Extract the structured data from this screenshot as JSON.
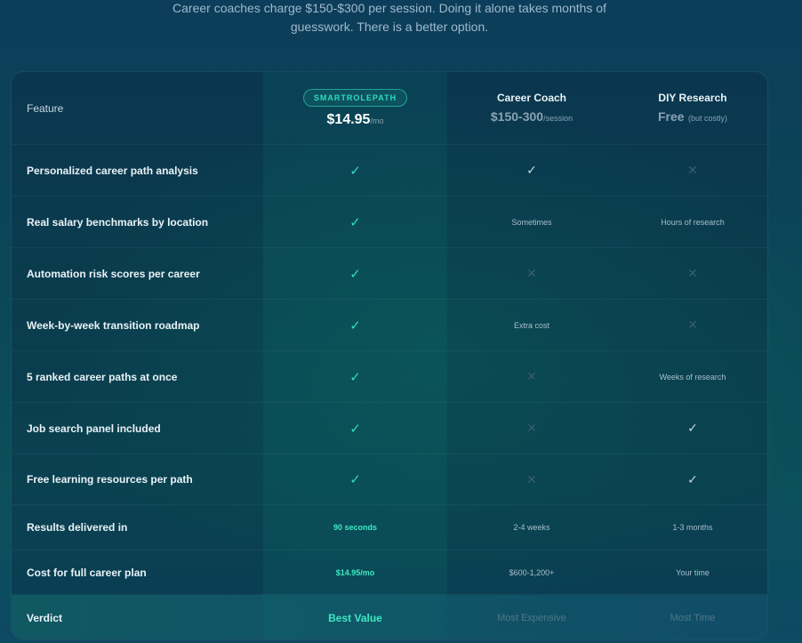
{
  "intro": {
    "line1": "Career coaches charge $150-$300 per session. Doing it alone takes months of",
    "line2": "guesswork. There is a better option."
  },
  "header": {
    "feature_label": "Feature",
    "plans": [
      {
        "badge": "SMARTROLEPATH",
        "price": "$14.95",
        "unit": "/mo"
      },
      {
        "name": "Career Coach",
        "price": "$150-300",
        "unit": "/session"
      },
      {
        "name": "DIY Research",
        "price": "Free",
        "unit": "(but costly)"
      }
    ]
  },
  "rows": [
    {
      "feature": "Personalized career path analysis",
      "values": [
        "✓",
        "✓",
        "✕"
      ]
    },
    {
      "feature": "Real salary benchmarks by location",
      "values": [
        "✓",
        "Sometimes",
        "Hours of research"
      ]
    },
    {
      "feature": "Automation risk scores per career",
      "values": [
        "✓",
        "✕",
        "✕"
      ]
    },
    {
      "feature": "Week-by-week transition roadmap",
      "values": [
        "✓",
        "Extra cost",
        "✕"
      ]
    },
    {
      "feature": "5 ranked career paths at once",
      "values": [
        "✓",
        "✕",
        "Weeks of research"
      ]
    },
    {
      "feature": "Job search panel included",
      "values": [
        "✓",
        "✕",
        "✓"
      ]
    },
    {
      "feature": "Free learning resources per path",
      "values": [
        "✓",
        "✕",
        "✓"
      ]
    },
    {
      "feature": "Results delivered in",
      "values": [
        "90 seconds",
        "2-4 weeks",
        "1-3 months"
      ]
    },
    {
      "feature": "Cost for full career plan",
      "values": [
        "$14.95/mo",
        "$600-1,200+",
        "Your time"
      ]
    }
  ],
  "verdict": {
    "label": "Verdict",
    "values": [
      "Best Value",
      "Most Expensive",
      "Most Time"
    ]
  },
  "colors": {
    "accent": "#2fdcbc",
    "background_top": "#0c3d5a",
    "background_mid": "#0b4f5b"
  }
}
